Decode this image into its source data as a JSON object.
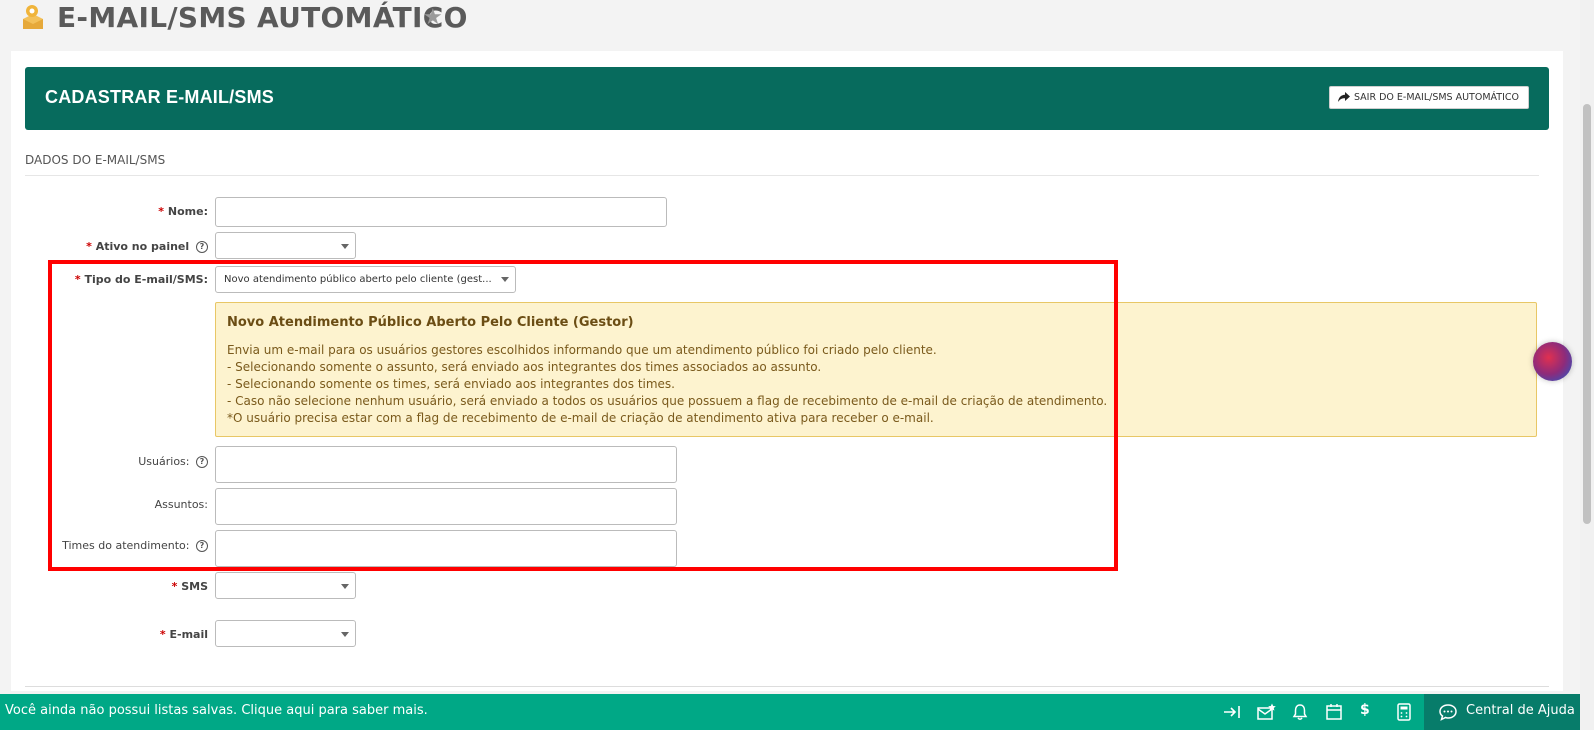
{
  "page": {
    "title": "E-MAIL/SMS AUTOMÁTICO"
  },
  "header": {
    "title": "CADASTRAR E-MAIL/SMS",
    "exit_button_label": "SAIR DO E-MAIL/SMS AUTOMÁTICO"
  },
  "section": {
    "title": "DADOS DO E-MAIL/SMS"
  },
  "form": {
    "nome_label": "Nome:",
    "ativo_label": "Ativo no painel",
    "tipo_label": "Tipo do E-mail/SMS:",
    "tipo_value": "Novo atendimento público aberto pelo cliente (gest...",
    "usuarios_label": "Usuários:",
    "assuntos_label": "Assuntos:",
    "times_label": "Times do atendimento:",
    "sms_label": "SMS",
    "email_label": "E-mail",
    "required_mark": "*"
  },
  "info": {
    "title": "Novo Atendimento Público Aberto Pelo Cliente (Gestor)",
    "lines": [
      "Envia um e-mail para os usuários gestores escolhidos informando que um atendimento público foi criado pelo cliente.",
      "- Selecionando somente o assunto, será enviado aos integrantes dos times associados ao assunto.",
      "- Selecionando somente os times, será enviado aos integrantes dos times.",
      "- Caso não selecione nenhum usuário, será enviado a todos os usuários que possuem a flag de recebimento de e-mail de criação de atendimento.",
      "*O usuário precisa estar com a flag de recebimento de e-mail de criação de atendimento ativa para receber o e-mail."
    ]
  },
  "footer": {
    "message": "Você ainda não possui listas salvas. Clique aqui para saber mais.",
    "help_label": "Central de Ajuda",
    "dollar": "$"
  },
  "colors": {
    "header_green": "#076b5d",
    "footer_green": "#00a886",
    "info_bg": "#fdf3cf",
    "highlight_red": "#ff0000"
  }
}
